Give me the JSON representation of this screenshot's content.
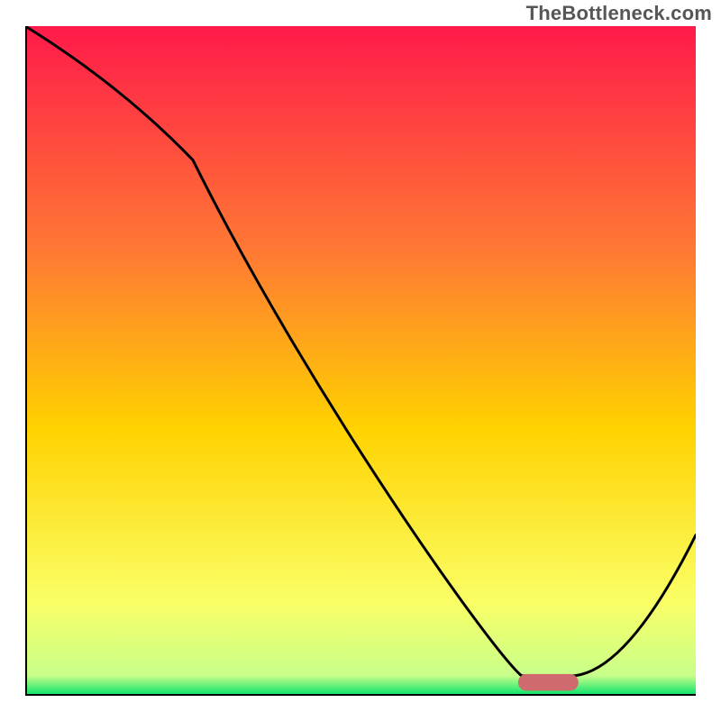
{
  "header": {
    "watermark": "TheBottleneck.com"
  },
  "chart_data": {
    "type": "line",
    "title": "",
    "xlabel": "",
    "ylabel": "",
    "xlim": [
      0,
      100
    ],
    "ylim": [
      0,
      100
    ],
    "gradient_colors": {
      "top": "#ff1a4a",
      "mid_upper": "#ff7a33",
      "mid": "#ffd200",
      "lower": "#faff66",
      "bottom": "#00e16a"
    },
    "series": [
      {
        "name": "bottleneck-curve",
        "x": [
          0,
          25,
          74,
          82,
          100
        ],
        "y": [
          100,
          80,
          3,
          3,
          24
        ]
      }
    ],
    "marker": {
      "name": "optimal-zone",
      "x_center": 78,
      "y_center": 2,
      "width": 9,
      "height": 2.5,
      "color": "#cf6a6f"
    },
    "axis_color": "#000000",
    "axis_width": 4
  }
}
